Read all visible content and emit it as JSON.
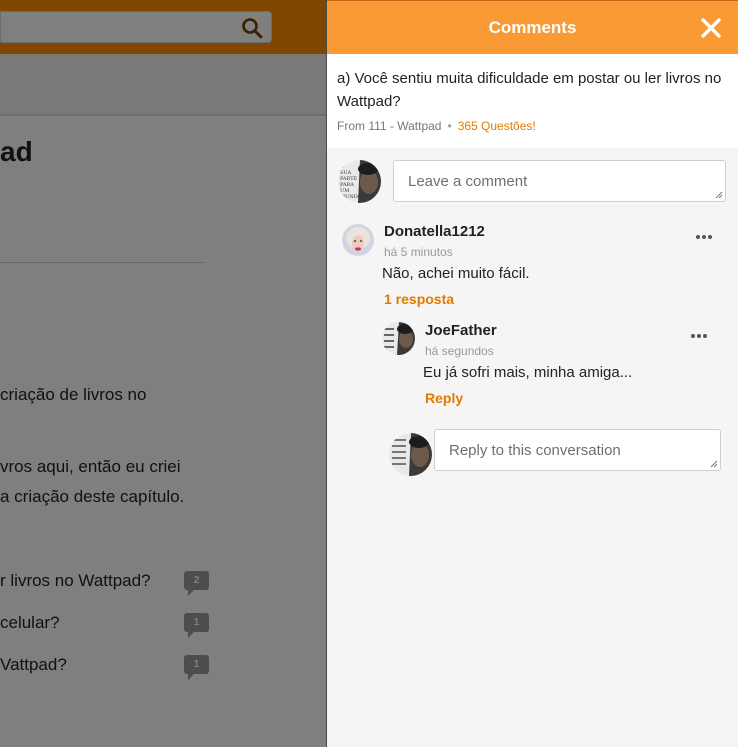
{
  "background": {
    "title": "ad",
    "lines": [
      "criação de livros no",
      "vros aqui, então eu criei",
      "a criação deste capítulo."
    ],
    "questions": [
      {
        "text": "r livros no Wattpad?",
        "count": "2"
      },
      {
        "text": " celular?",
        "count": "1"
      },
      {
        "text": "Vattpad?",
        "count": "1"
      }
    ]
  },
  "panel": {
    "title": "Comments",
    "question": {
      "text": "a) Você sentiu muita dificuldade em postar ou ler livros no Wattpad?",
      "source": "From 111 - Wattpad",
      "separator": "•",
      "link": "365 Questões!"
    },
    "comment_input": {
      "placeholder": "Leave a comment"
    },
    "comments": [
      {
        "author": "Donatella1212",
        "time": "há 5 minutos",
        "body": "Não, achei muito fácil.",
        "replies_link": "1 resposta"
      }
    ],
    "replies": [
      {
        "author": "JoeFather",
        "time": "há segundos",
        "body": "Eu já sofri mais, minha amiga...",
        "reply_link": "Reply"
      }
    ],
    "reply_input": {
      "placeholder": "Reply to this conversation"
    },
    "avatar_text": [
      "A",
      "SUA",
      "PARTE",
      "PARA",
      "UM",
      "MUNDO",
      "MELHOR"
    ]
  },
  "colors": {
    "header": "#f99a35",
    "link": "#e07a00",
    "panel_bg": "#f5f5f5"
  }
}
